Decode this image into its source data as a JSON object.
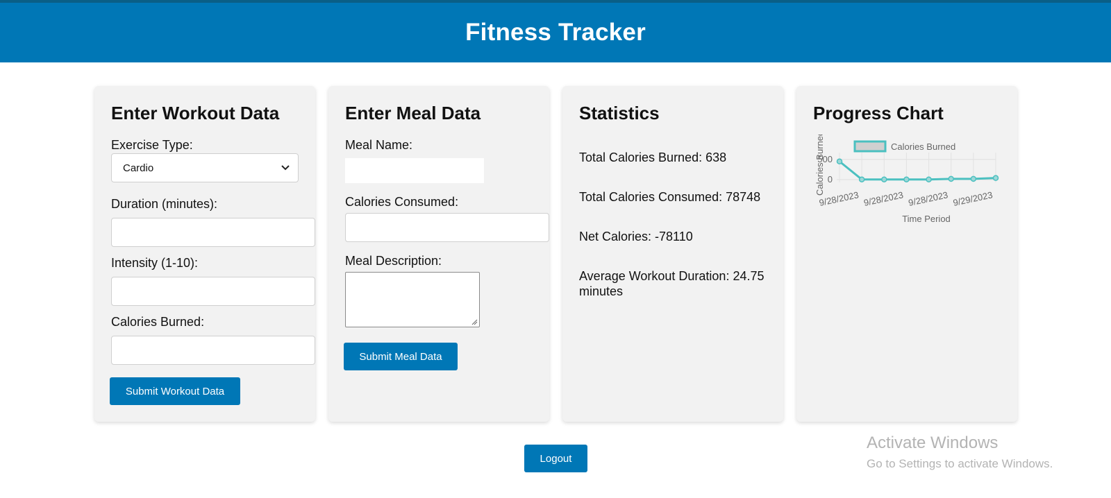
{
  "header": {
    "title": "Fitness Tracker"
  },
  "workout": {
    "title": "Enter Workout Data",
    "exercise_label": "Exercise Type:",
    "exercise_value": "Cardio",
    "duration_label": "Duration (minutes):",
    "intensity_label": "Intensity (1-10):",
    "calories_label": "Calories Burned:",
    "submit_label": "Submit Workout Data"
  },
  "meal": {
    "title": "Enter Meal Data",
    "name_label": "Meal Name:",
    "calories_label": "Calories Consumed:",
    "description_label": "Meal Description:",
    "submit_label": "Submit Meal Data"
  },
  "stats": {
    "title": "Statistics",
    "total_burned": "Total Calories Burned: 638",
    "total_consumed": "Total Calories Consumed: 78748",
    "net": "Net Calories: -78110",
    "avg_duration": "Average Workout Duration: 24.75 minutes"
  },
  "progress": {
    "title": "Progress Chart"
  },
  "chart_data": {
    "type": "line",
    "title": "",
    "xlabel": "Time Period",
    "ylabel": "Calories Burned",
    "x": [
      "9/28/2023",
      "9/28/2023",
      "9/28/2023",
      "9/28/2023",
      "9/28/2023",
      "9/29/2023",
      "9/29/2023",
      "9/29/2023"
    ],
    "x_tick_labels": [
      "9/28/2023",
      "9/28/2023",
      "9/28/2023",
      "9/29/2023"
    ],
    "y_ticks": [
      "500",
      "0"
    ],
    "ylim": [
      0,
      600
    ],
    "series": [
      {
        "name": "Calories Burned",
        "values": [
          450,
          5,
          5,
          5,
          5,
          20,
          20,
          40
        ]
      }
    ],
    "legend": "top",
    "grid": true,
    "colors": {
      "line": "#4bc0c0",
      "legend_fill": "#d0d0d0"
    }
  },
  "footer": {
    "logout_label": "Logout"
  },
  "watermark": {
    "title": "Activate Windows",
    "subtitle": "Go to Settings to activate Windows."
  },
  "colors": {
    "primary": "#0077b6",
    "card_bg": "#f2f2f2"
  }
}
